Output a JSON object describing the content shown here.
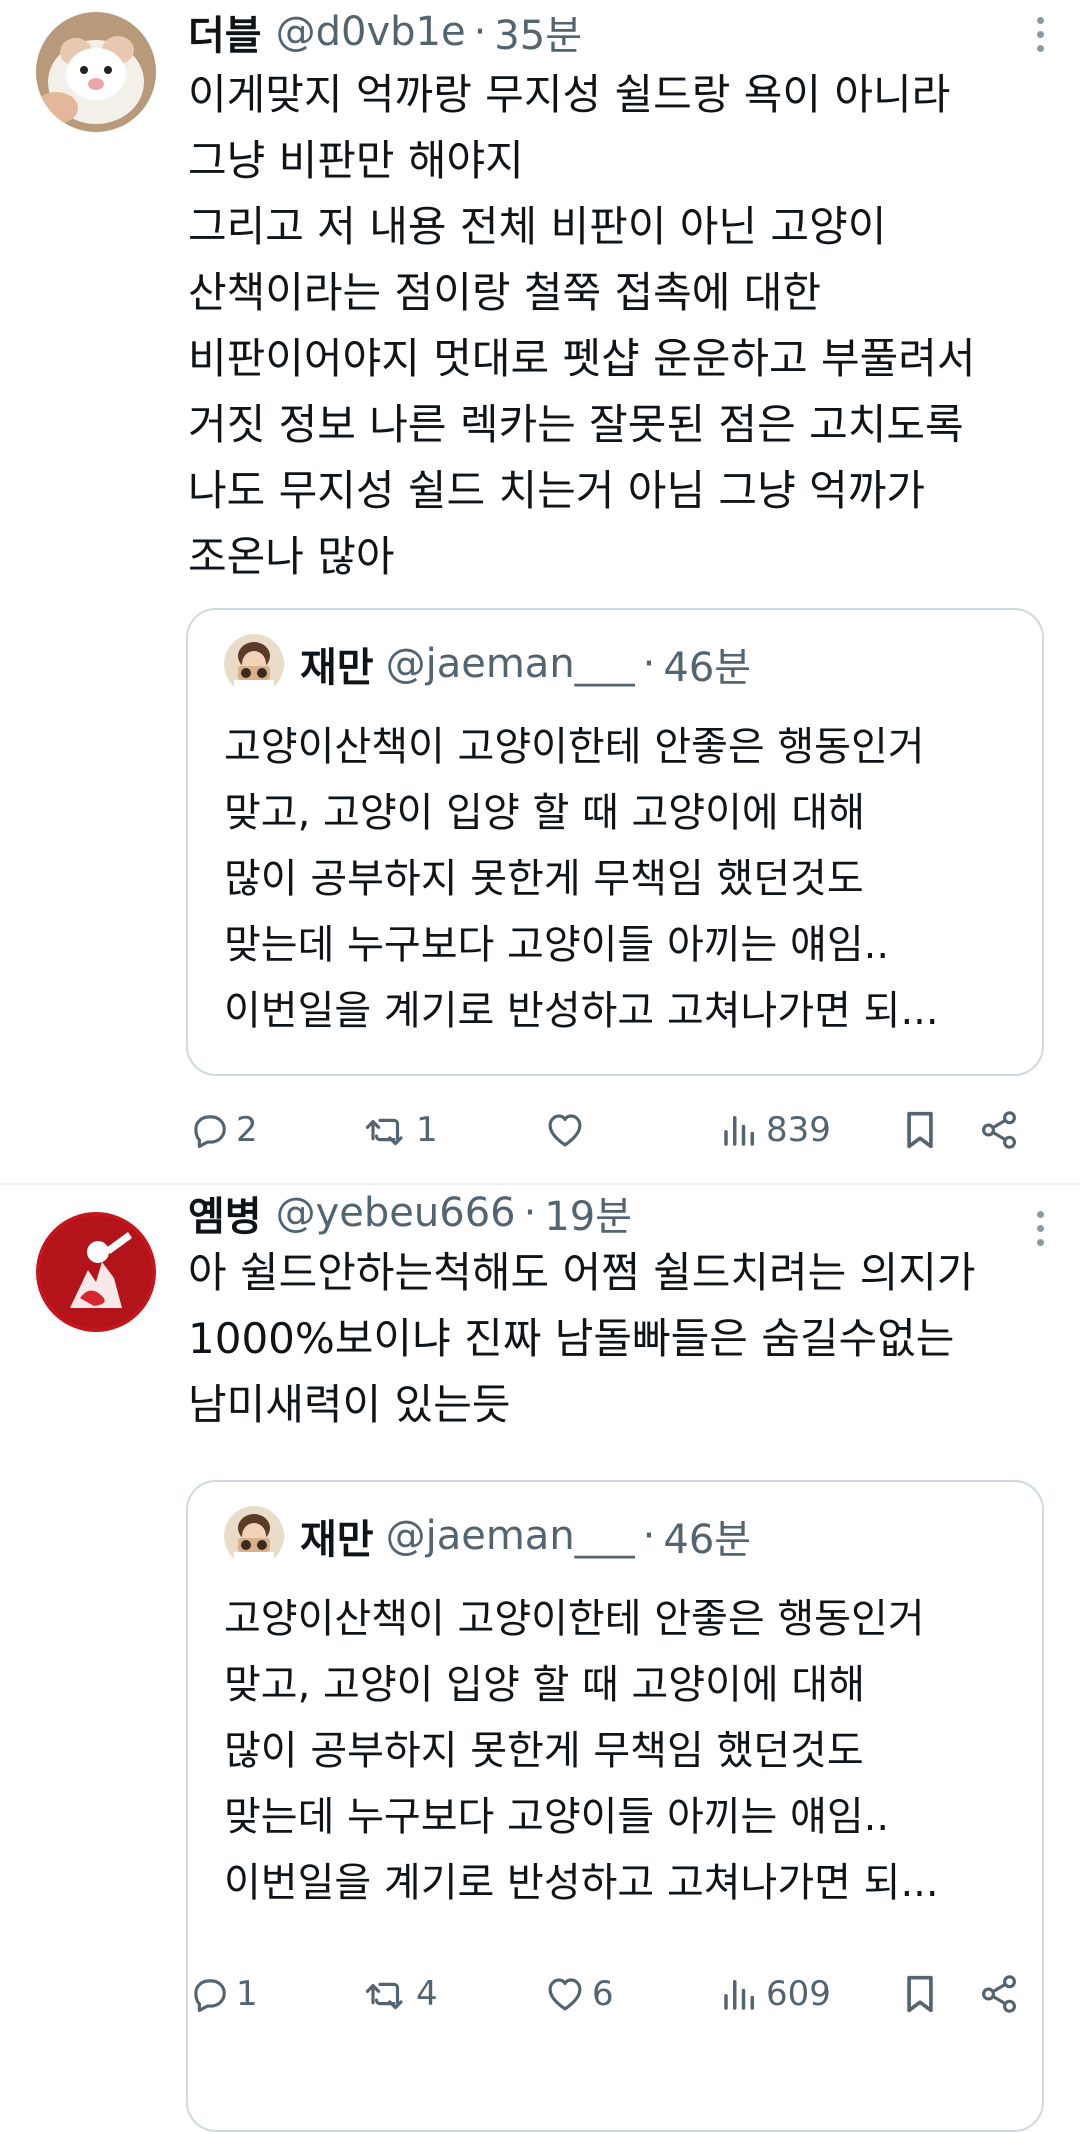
{
  "tweets": [
    {
      "avatar": "hamster-avatar",
      "name": "더블",
      "handle": "@d0vb1e",
      "separator": "·",
      "time": "35분",
      "text": "이게맞지 억까랑 무지성 쉴드랑 욕이 아니라\n그냥 비판만 해야지\n그리고 저 내용 전체 비판이 아닌 고양이\n산책이라는 점이랑 철쭉 접촉에 대한\n비판이어야지 멋대로 펫샵 운운하고 부풀려서\n거짓 정보 나른 렉카는 잘못된 점은 고치도록\n나도 무지성 쉴드 치는거 아님 그냥 억까가\n조온나 많아",
      "quote": {
        "name": "재만",
        "handle": "@jaeman___",
        "separator": "·",
        "time": "46분",
        "text": "고양이산책이 고양이한테 안좋은 행동인거\n맞고, 고양이 입양 할 때 고양이에 대해\n많이 공부하지 못한게 무책임 했던것도\n맞는데 누구보다 고양이들 아끼는 얘임..\n이번일을 계기로 반성하고 고쳐나가면 되..."
      },
      "metrics": {
        "replies": "2",
        "retweets": "1",
        "likes": "",
        "views": "839"
      }
    },
    {
      "avatar": "red-illustration-avatar",
      "name": "옘병",
      "handle": "@yebeu666",
      "separator": "·",
      "time": "19분",
      "text": "아 쉴드안하는척해도 어쩜 쉴드치려는 의지가\n1000%보이냐 진짜    남돌빠들은 숨길수없는\n남미새력이 있는듯",
      "quote": {
        "name": "재만",
        "handle": "@jaeman___",
        "separator": "·",
        "time": "46분",
        "text": "고양이산책이 고양이한테 안좋은 행동인거\n맞고, 고양이 입양 할 때 고양이에 대해\n많이 공부하지 못한게 무책임 했던것도\n맞는데 누구보다 고양이들 아끼는 얘임..\n이번일을 계기로 반성하고 고쳐나가면 되..."
      },
      "metrics": {
        "replies": "1",
        "retweets": "4",
        "likes": "6",
        "views": "609"
      }
    }
  ],
  "icons": {
    "reply": "reply-icon",
    "retweet": "retweet-icon",
    "like": "heart-icon",
    "views": "views-bar-icon",
    "bookmark": "bookmark-icon",
    "share": "share-icon",
    "more": "more-vertical-icon"
  },
  "colors": {
    "text": "#0f1419",
    "secondary": "#536471",
    "border": "#cfd9de",
    "divider": "#eff3f4"
  }
}
